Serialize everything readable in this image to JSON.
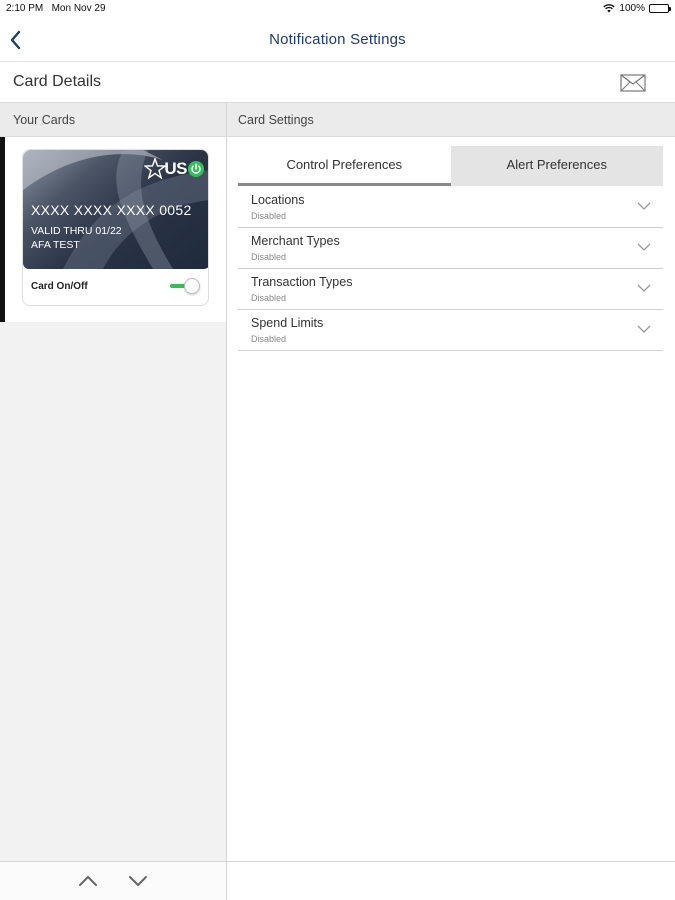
{
  "status_bar": {
    "time": "2:10 PM",
    "date": "Mon Nov 29",
    "battery": "100%"
  },
  "nav": {
    "title": "Notification Settings",
    "back_icon": "chevron-left-icon"
  },
  "details": {
    "title": "Card Details",
    "mail_icon": "envelope-icon"
  },
  "your_cards": {
    "header": "Your Cards",
    "card": {
      "logo_text": "US",
      "number": "XXXX XXXX XXXX 0052",
      "valid_thru": "VALID THRU 01/22",
      "name": "AFA TEST",
      "on_off_label": "Card On/Off",
      "enabled": true
    }
  },
  "card_settings": {
    "header": "Card Settings",
    "tabs": [
      {
        "label": "Control Preferences",
        "active": true
      },
      {
        "label": "Alert Preferences",
        "active": false
      }
    ],
    "items": [
      {
        "title": "Locations",
        "status": "Disabled"
      },
      {
        "title": "Merchant Types",
        "status": "Disabled"
      },
      {
        "title": "Transaction Types",
        "status": "Disabled"
      },
      {
        "title": "Spend Limits",
        "status": "Disabled"
      }
    ]
  },
  "colors": {
    "nav_title": "#1f3b7a",
    "toggle_on": "#34c04f",
    "power_green": "#33c05a"
  }
}
